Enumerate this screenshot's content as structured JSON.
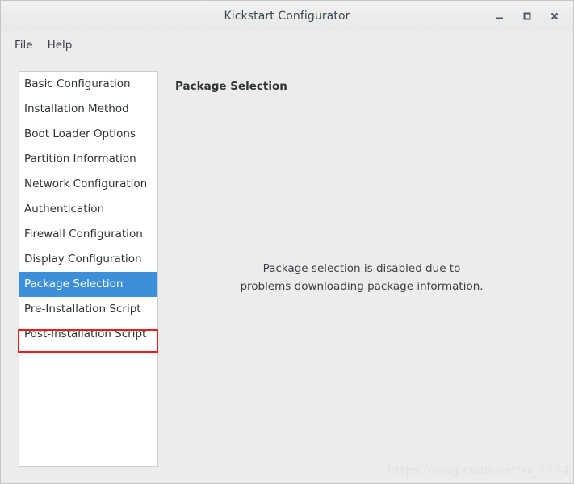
{
  "window": {
    "title": "Kickstart Configurator",
    "controls": [
      {
        "name": "minimize-button",
        "glyph": "minimize"
      },
      {
        "name": "maximize-button",
        "glyph": "maximize"
      },
      {
        "name": "close-button",
        "glyph": "close"
      }
    ]
  },
  "menubar": {
    "items": [
      {
        "label": "File"
      },
      {
        "label": "Help"
      }
    ]
  },
  "sidebar": {
    "items": [
      {
        "label": "Basic Configuration",
        "selected": false
      },
      {
        "label": "Installation Method",
        "selected": false
      },
      {
        "label": "Boot Loader Options",
        "selected": false
      },
      {
        "label": "Partition Information",
        "selected": false
      },
      {
        "label": "Network Configuration",
        "selected": false
      },
      {
        "label": "Authentication",
        "selected": false
      },
      {
        "label": "Firewall Configuration",
        "selected": false
      },
      {
        "label": "Display Configuration",
        "selected": false
      },
      {
        "label": "Package Selection",
        "selected": true
      },
      {
        "label": "Pre-Installation Script",
        "selected": false
      },
      {
        "label": "Post-Installation Script",
        "selected": false
      }
    ]
  },
  "main": {
    "pane_title": "Package Selection",
    "message_line1": "Package selection is disabled due to",
    "message_line2": "problems downloading package information."
  },
  "watermark": {
    "text": "https://blog.csdn.net/sr_1114"
  },
  "colors": {
    "selection_blue": "#3d8fd9",
    "annotation_red": "#ef1a1a",
    "window_background": "#ececec",
    "list_background": "#ffffff",
    "text": "#2e3436",
    "title_text": "#3c4a52"
  }
}
